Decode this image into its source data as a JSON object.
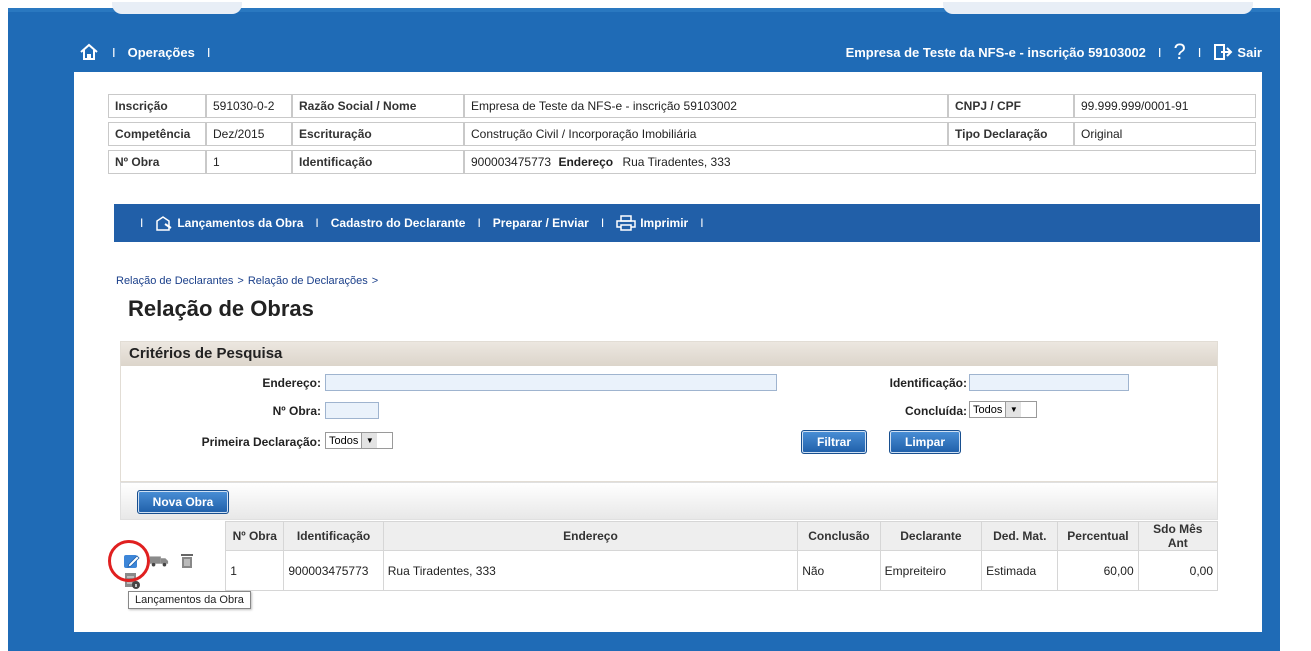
{
  "topnav": {
    "operacoes": "Operações",
    "empresa": "Empresa de Teste da NFS-e - inscrição 59103002",
    "sair": "Sair"
  },
  "info": {
    "inscricao_label": "Inscrição",
    "inscricao_value": "591030-0-2",
    "razao_label": "Razão Social / Nome",
    "razao_value": "Empresa de Teste da NFS-e - inscrição 59103002",
    "cnpj_label": "CNPJ / CPF",
    "cnpj_value": "99.999.999/0001-91",
    "competencia_label": "Competência",
    "competencia_value": "Dez/2015",
    "escrituracao_label": "Escrituração",
    "escrituracao_value": "Construção Civil / Incorporação Imobiliária",
    "tipo_label": "Tipo Declaração",
    "tipo_value": "Original",
    "obra_label": "Nº Obra",
    "obra_value": "1",
    "identificacao_label": "Identificação",
    "identificacao_value": "900003475773",
    "endereco_label": "Endereço",
    "endereco_value": "Rua Tiradentes, 333"
  },
  "secnav": {
    "lancamentos": "Lançamentos da Obra",
    "cadastro": "Cadastro do Declarante",
    "preparar": "Preparar / Enviar",
    "imprimir": "Imprimir"
  },
  "breadcrumb": {
    "item1": "Relação de Declarantes",
    "item2": "Relação de Declarações",
    "sep": ">"
  },
  "page_title": "Relação de Obras",
  "criteria": {
    "title": "Critérios de Pesquisa",
    "endereco_label": "Endereço:",
    "endereco_value": "",
    "identificacao_label": "Identificação:",
    "identificacao_value": "",
    "nobra_label": "Nº Obra:",
    "nobra_value": "",
    "concluida_label": "Concluída:",
    "concluida_value": "Todos",
    "primeira_label": "Primeira Declaração:",
    "primeira_value": "Todos",
    "filtrar": "Filtrar",
    "limpar": "Limpar"
  },
  "toolbar": {
    "nova_obra": "Nova Obra"
  },
  "grid": {
    "headers": [
      "Nº Obra",
      "Identificação",
      "Endereço",
      "Conclusão",
      "Declarante",
      "Ded. Mat.",
      "Percentual",
      "Sdo Mês Ant"
    ],
    "rows": [
      {
        "obra": "1",
        "identificacao": "900003475773",
        "endereco": "Rua Tiradentes, 333",
        "conclusao": "Não",
        "declarante": "Empreiteiro",
        "ded_mat": "Estimada",
        "percentual": "60,00",
        "sdo": "0,00"
      }
    ]
  },
  "tooltip": "Lançamentos da Obra",
  "colors": {
    "brand_blue": "#1f6bb6",
    "nav_blue": "#215fa8",
    "highlight": "#e02020"
  }
}
